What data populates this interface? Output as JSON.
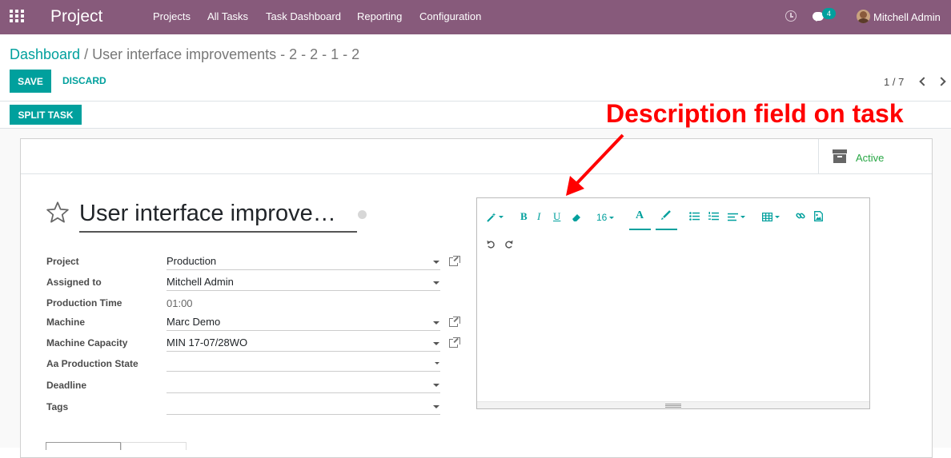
{
  "navbar": {
    "brand": "Project",
    "menu": [
      "Projects",
      "All Tasks",
      "Task Dashboard",
      "Reporting",
      "Configuration"
    ],
    "chat_count": "4",
    "user_name": "Mitchell Admin",
    "color": "#875a7b"
  },
  "breadcrumb": {
    "parent": "Dashboard",
    "separator": "/",
    "current": "User interface improvements - 2 - 2 - 1 - 2"
  },
  "buttons": {
    "save": "SAVE",
    "discard": "DISCARD",
    "split_task": "SPLIT TASK"
  },
  "pager": {
    "value": "1 / 7"
  },
  "status_button": {
    "label": "Active",
    "icon": "archive-icon"
  },
  "task": {
    "title": "User interface improve…",
    "fields": [
      {
        "label": "Project",
        "value": "Production",
        "type": "many2one",
        "external_link": true
      },
      {
        "label": "Assigned to",
        "value": "Mitchell Admin",
        "type": "many2one",
        "external_link": false
      },
      {
        "label": "Production Time",
        "value": "01:00",
        "type": "static",
        "external_link": false
      },
      {
        "label": "Machine",
        "value": "Marc Demo",
        "type": "many2one",
        "external_link": true
      },
      {
        "label": "Machine Capacity",
        "value": "MIN 17-07/28WO",
        "type": "many2one",
        "external_link": true
      },
      {
        "label": "Aa Production State",
        "value": "",
        "type": "select",
        "external_link": false
      },
      {
        "label": "Deadline",
        "value": "",
        "type": "date",
        "external_link": false
      },
      {
        "label": "Tags",
        "value": "",
        "type": "many2many",
        "external_link": false
      }
    ]
  },
  "editor": {
    "font_size": "16",
    "bold": "B",
    "italic": "I",
    "underline": "U",
    "font_color": "A"
  },
  "annotation": {
    "text": "Description field on task",
    "color": "#ff0000"
  },
  "colors": {
    "accent": "#00a09d",
    "active": "#28a745"
  }
}
